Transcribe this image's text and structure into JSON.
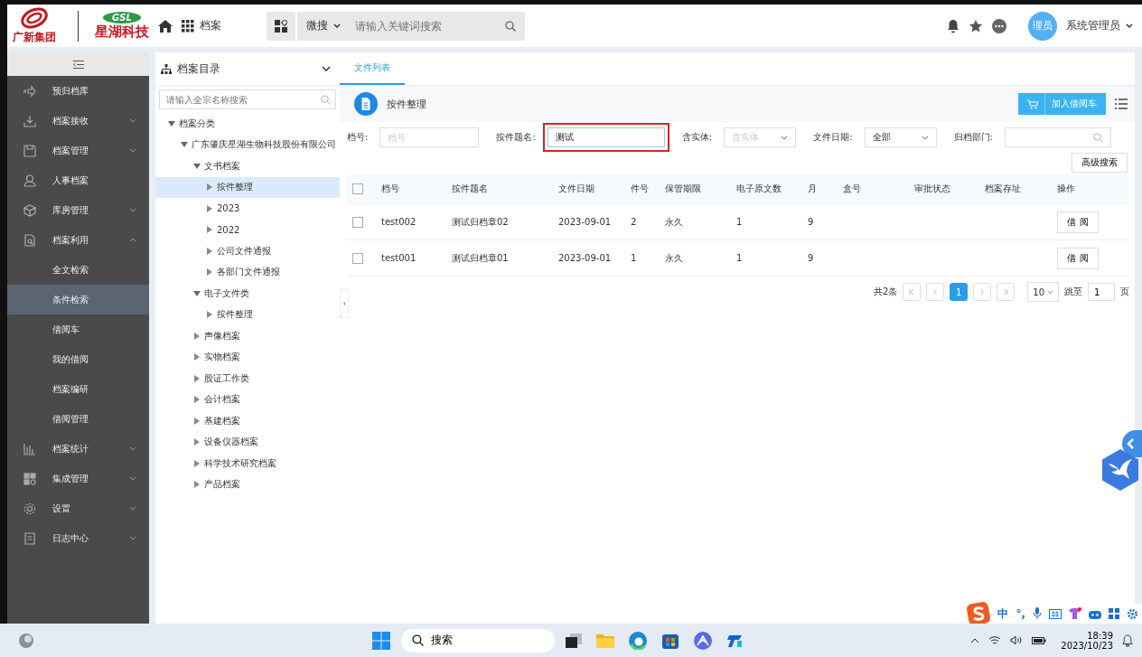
{
  "header": {
    "logos": [
      {
        "text": "广新集团"
      },
      {
        "badge": "GSL",
        "text": "星湖科技"
      }
    ],
    "nav_label": "档案",
    "search_scope": "微搜",
    "search": {
      "placeholder": "请输入关键词搜索"
    },
    "avatar": "理员",
    "user": "系统管理员"
  },
  "sidebar": {
    "items": [
      {
        "label": "预归档库",
        "kind": "link",
        "selected": false
      },
      {
        "label": "档案接收",
        "kind": "group",
        "expanded": false,
        "selected": false
      },
      {
        "label": "档案管理",
        "kind": "group",
        "expanded": false,
        "selected": false
      },
      {
        "label": "人事档案",
        "kind": "link",
        "selected": false
      },
      {
        "label": "库房管理",
        "kind": "group",
        "expanded": false,
        "selected": false
      },
      {
        "label": "档案利用",
        "kind": "group",
        "expanded": true,
        "selected": false
      },
      {
        "label": "全文检索",
        "kind": "sub",
        "selected": false
      },
      {
        "label": "条件检索",
        "kind": "sub",
        "selected": true
      },
      {
        "label": "借阅车",
        "kind": "sub",
        "selected": false
      },
      {
        "label": "我的借阅",
        "kind": "sub",
        "selected": false
      },
      {
        "label": "档案编研",
        "kind": "sub",
        "selected": false
      },
      {
        "label": "借阅管理",
        "kind": "sub",
        "selected": false
      },
      {
        "label": "档案统计",
        "kind": "group",
        "expanded": false,
        "selected": false
      },
      {
        "label": "集成管理",
        "kind": "group",
        "expanded": false,
        "selected": false
      },
      {
        "label": "设置",
        "kind": "group",
        "expanded": false,
        "selected": false
      },
      {
        "label": "日志中心",
        "kind": "group",
        "expanded": false,
        "selected": false
      }
    ]
  },
  "tree": {
    "title": "档案目录",
    "search": {
      "placeholder": "请输入全宗名称搜索"
    },
    "nodes": [
      {
        "label": "档案分类",
        "expanded": true,
        "selected": false,
        "children": [
          {
            "label": "广东肇庆星湖生物科技股份有限公司",
            "expanded": true,
            "selected": false,
            "children": [
              {
                "label": "文书档案",
                "expanded": true,
                "selected": false,
                "children": [
                  {
                    "label": "按件整理",
                    "expanded": false,
                    "selected": true
                  },
                  {
                    "label": "2023",
                    "expanded": false,
                    "selected": false
                  },
                  {
                    "label": "2022",
                    "expanded": false,
                    "selected": false
                  },
                  {
                    "label": "公司文件通报",
                    "expanded": false,
                    "selected": false
                  },
                  {
                    "label": "各部门文件通报",
                    "expanded": false,
                    "selected": false
                  }
                ]
              },
              {
                "label": "电子文件类",
                "expanded": true,
                "selected": false,
                "children": [
                  {
                    "label": "按件整理",
                    "expanded": false,
                    "selected": false
                  }
                ]
              },
              {
                "label": "声像档案",
                "expanded": false,
                "selected": false
              },
              {
                "label": "实物档案",
                "expanded": false,
                "selected": false
              },
              {
                "label": "股证工作类",
                "expanded": false,
                "selected": false
              },
              {
                "label": "会计档案",
                "expanded": false,
                "selected": false
              },
              {
                "label": "基建档案",
                "expanded": false,
                "selected": false
              },
              {
                "label": "设备仪器档案",
                "expanded": false,
                "selected": false
              },
              {
                "label": "科学技术研究档案",
                "expanded": false,
                "selected": false
              },
              {
                "label": "产品档案",
                "expanded": false,
                "selected": false
              }
            ]
          }
        ]
      }
    ]
  },
  "tabs": [
    {
      "label": "文件列表",
      "selected": true
    }
  ],
  "panel": {
    "title": "按件整理",
    "cart_button": "加入借阅车"
  },
  "filters": [
    {
      "label": "档号:",
      "kind": "text",
      "placeholder": "档号",
      "highlighted": false
    },
    {
      "label": "按件题名:",
      "kind": "text",
      "value": "测试",
      "highlighted": true
    },
    {
      "label": "含实体:",
      "kind": "select",
      "placeholder": "含实体",
      "highlighted": false
    },
    {
      "label": "文件日期:",
      "kind": "select",
      "value": "全部",
      "highlighted": false
    },
    {
      "label": "归档部门:",
      "kind": "search",
      "highlighted": false
    }
  ],
  "advanced_button": "高级搜索",
  "table": {
    "select_all": {
      "checked": false
    },
    "columns": [
      "档号",
      "按件题名",
      "文件日期",
      "件号",
      "保管期限",
      "电子原文数",
      "月",
      "盒号",
      "审批状态",
      "档案存址",
      "操作"
    ],
    "rows": [
      {
        "checked": false,
        "cells": [
          "test002",
          "测试归档章02",
          "2023-09-01",
          "2",
          "永久",
          "1",
          "9",
          "",
          "",
          ""
        ],
        "action": "借 阅"
      },
      {
        "checked": false,
        "cells": [
          "test001",
          "测试归档章01",
          "2023-09-01",
          "1",
          "永久",
          "1",
          "9",
          "",
          "",
          ""
        ],
        "action": "借 阅"
      }
    ]
  },
  "pagination": {
    "total": "共2条",
    "pages": [
      {
        "label": "1",
        "selected": true
      }
    ],
    "page_size": "10",
    "jump_label": "跳至",
    "jump_value": "1",
    "page_suffix": "页"
  },
  "ime_bar": [
    "中",
    "°,"
  ],
  "taskbar": {
    "search": "搜索",
    "time": "18:39",
    "date": "2023/10/23"
  }
}
